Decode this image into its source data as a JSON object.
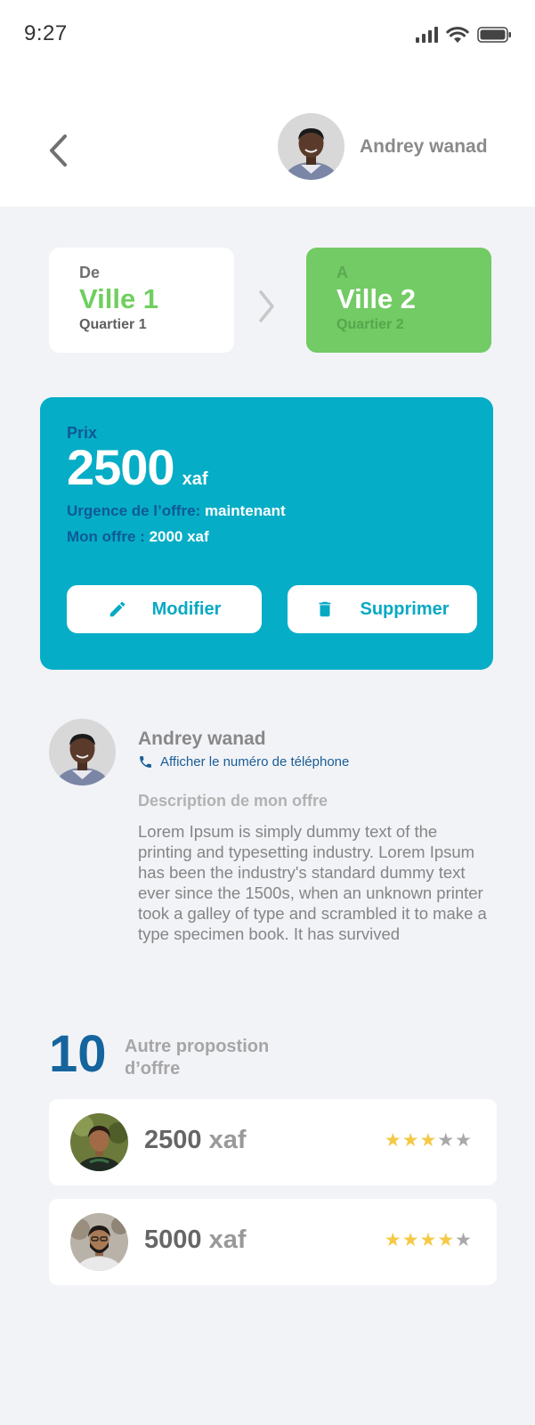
{
  "status_bar": {
    "time": "9:27"
  },
  "header": {
    "user_name": "Andrey wanad"
  },
  "route": {
    "from": {
      "label": "De",
      "city": "Ville 1",
      "district": "Quartier 1"
    },
    "to": {
      "label": "A",
      "city": "Ville 2",
      "district": "Quartier 2"
    }
  },
  "offer": {
    "price_label": "Prix",
    "price": "2500",
    "currency": "xaf",
    "urgency_label": "Urgence de l’offre:",
    "urgency_value": "maintenant",
    "my_offer_label": "Mon offre :",
    "my_offer_value": "2000 xaf",
    "edit_label": "Modifier",
    "delete_label": "Supprimer"
  },
  "poster": {
    "name": "Andrey wanad",
    "phone_link": "Afficher le numéro de téléphone",
    "description_title": "Description de mon offre",
    "description": "Lorem Ipsum is simply dummy text of the printing and typesetting industry. Lorem Ipsum has been the industry's standard dummy text ever since the 1500s, when an unknown printer took a galley of type and scrambled it to make a type specimen book. It has survived"
  },
  "proposals": {
    "count": "10",
    "label": "Autre propostion d’offre",
    "items": [
      {
        "amount": "2500",
        "currency": "xaf",
        "rating": 3,
        "max_rating": 5
      },
      {
        "amount": "5000",
        "currency": "xaf",
        "rating": 4,
        "max_rating": 5
      }
    ]
  },
  "colors": {
    "accent_green": "#72cb64",
    "accent_cyan": "#06adc6",
    "accent_blue": "#0e5a97",
    "star_on": "#f5c945",
    "star_off": "#a9a9a9"
  }
}
